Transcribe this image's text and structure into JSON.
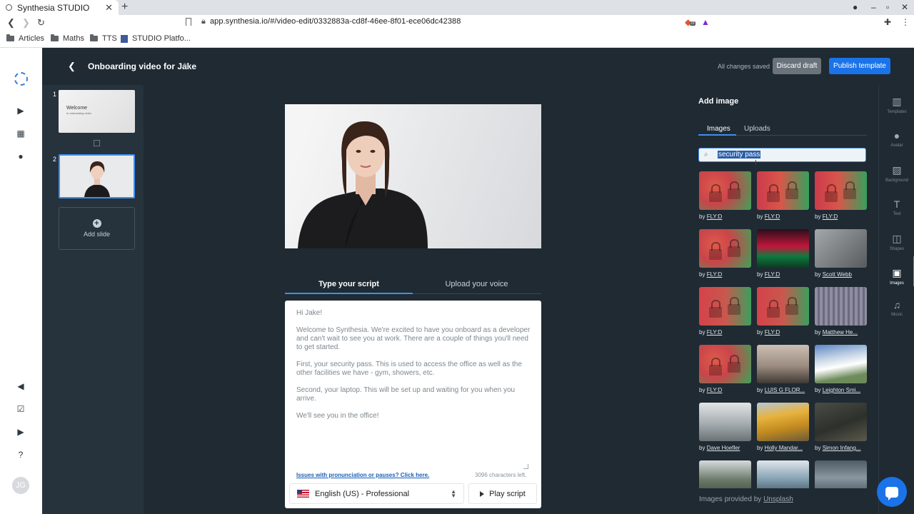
{
  "browser": {
    "tab_title": "Synthesia STUDIO",
    "tab_close": "✕",
    "new_tab": "+",
    "url": "app.synthesia.io/#/video-edit/0332883a-cd8f-46ee-8f01-ece06dc42388",
    "extension_badge": "23",
    "bookmarks": [
      "Articles",
      "Maths",
      "TTS",
      "STUDIO Platfo..."
    ]
  },
  "topbar": {
    "video_title": "Onboarding video for Jake",
    "save_status": "All changes saved",
    "discard_label": "Discard draft",
    "publish_label": "Publish template"
  },
  "slides": {
    "items": [
      {
        "number": "1",
        "title": "Welcome",
        "subtitle": "to onboarding video"
      },
      {
        "number": "2"
      }
    ],
    "add_label": "Add slide"
  },
  "script": {
    "tabs": [
      "Type your script",
      "Upload your voice"
    ],
    "paragraphs": [
      "Hi Jake!",
      "Welcome to Synthesia. We're excited to have you onboard as a developer and can't wait to see you at work. There are a couple of things you'll need to get started.",
      "First, your security pass. This is used to access the office as well as the other facilities we have - gym, showers, etc.",
      "Second, your laptop. This will be set up and waiting for you when you arrive.",
      "We'll see you in the office!"
    ],
    "pronunciation_link": "Issues with pronunciation or pauses? Click here.",
    "chars_left": "3096 characters left.",
    "voice": "English (US) - Professional",
    "play_label": "Play script"
  },
  "panel": {
    "title": "Add image",
    "tabs": [
      "Images",
      "Uploads"
    ],
    "search_value": "security pass",
    "by_prefix": "by",
    "images": [
      {
        "author": "FLY:D",
        "style": "img-lock"
      },
      {
        "author": "FLY:D",
        "style": "img-lock2"
      },
      {
        "author": "FLY:D",
        "style": "img-lock2"
      },
      {
        "author": "FLY:D",
        "style": "img-lock"
      },
      {
        "author": "FLY:D",
        "style": "img-pc"
      },
      {
        "author": "Scott Webb",
        "style": "img-door"
      },
      {
        "author": "FLY:D",
        "style": "img-lock3"
      },
      {
        "author": "FLY:D",
        "style": "img-lock3"
      },
      {
        "author": "Matthew He...",
        "style": "img-metal"
      },
      {
        "author": "FLY:D",
        "style": "img-lock"
      },
      {
        "author": "LUIS G FLOR...",
        "style": "img-silh"
      },
      {
        "author": "Leighton Smi...",
        "style": "img-snow"
      },
      {
        "author": "Dave Hoefler",
        "style": "img-fog"
      },
      {
        "author": "Holly Mandar...",
        "style": "img-aspen"
      },
      {
        "author": "Simon Infang...",
        "style": "img-rock"
      },
      {
        "author": "",
        "style": "img-mtn"
      },
      {
        "author": "",
        "style": "img-lake"
      },
      {
        "author": "",
        "style": "img-valley"
      }
    ],
    "provided_prefix": "Images provided by",
    "provided_link": "Unsplash"
  },
  "rightrail": {
    "items": [
      {
        "label": "Templates",
        "icon": "templates-icon",
        "glyph": "▥"
      },
      {
        "label": "Avatar",
        "icon": "avatar-icon",
        "glyph": "●"
      },
      {
        "label": "Background",
        "icon": "background-icon",
        "glyph": "▨"
      },
      {
        "label": "Text",
        "icon": "text-icon",
        "glyph": "T"
      },
      {
        "label": "Shapes",
        "icon": "shapes-icon",
        "glyph": "◫"
      },
      {
        "label": "Images",
        "icon": "image-icon",
        "glyph": "▣"
      },
      {
        "label": "Music",
        "icon": "music-icon",
        "glyph": "♫"
      }
    ],
    "active": "Images"
  },
  "user": {
    "initials": "JG"
  },
  "colors": {
    "accent": "#1a73e8",
    "selection": "#3d8ff0",
    "dark_bg": "#1f2a33"
  }
}
